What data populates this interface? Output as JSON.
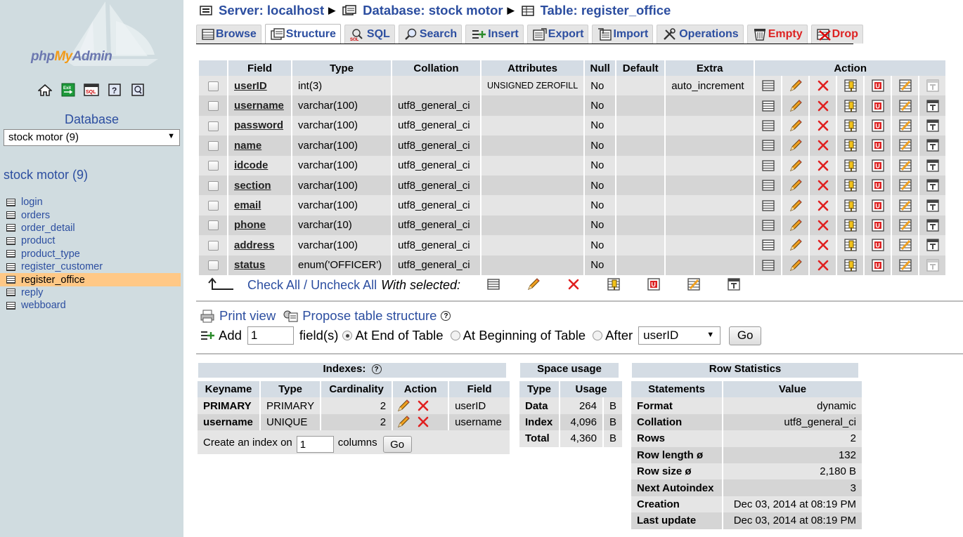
{
  "sidebar": {
    "logo": {
      "part1": "php",
      "part2": "My",
      "part3": "Admin"
    },
    "quick_icons": [
      "home-icon",
      "exit-icon",
      "sql-query-icon",
      "docs-icon",
      "sql-docs-icon"
    ],
    "database_label": "Database",
    "database_select": "stock motor (9)",
    "database_title": "stock motor (9)",
    "tables": [
      {
        "label": "login"
      },
      {
        "label": "orders"
      },
      {
        "label": "order_detail"
      },
      {
        "label": "product"
      },
      {
        "label": "product_type"
      },
      {
        "label": "register_customer"
      },
      {
        "label": "register_office",
        "active": true
      },
      {
        "label": "reply"
      },
      {
        "label": "webboard"
      }
    ],
    "active_color": "#ffc886"
  },
  "breadcrumb": {
    "server": "Server: localhost",
    "database": "Database: stock motor",
    "table": "Table: register_office"
  },
  "tabs": [
    {
      "label": "Browse",
      "icon": "browse-icon"
    },
    {
      "label": "Structure",
      "icon": "structure-icon",
      "active": true
    },
    {
      "label": "SQL",
      "icon": "sql-icon"
    },
    {
      "label": "Search",
      "icon": "search-icon"
    },
    {
      "label": "Insert",
      "icon": "insert-icon"
    },
    {
      "label": "Export",
      "icon": "export-icon"
    },
    {
      "label": "Import",
      "icon": "import-icon"
    },
    {
      "label": "Operations",
      "icon": "operations-icon"
    },
    {
      "label": "Empty",
      "icon": "empty-icon",
      "danger": true
    },
    {
      "label": "Drop",
      "icon": "drop-icon",
      "danger": true
    }
  ],
  "structure": {
    "headers": {
      "field": "Field",
      "type": "Type",
      "collation": "Collation",
      "attributes": "Attributes",
      "null": "Null",
      "default": "Default",
      "extra": "Extra",
      "action": "Action"
    },
    "rows": [
      {
        "field": "userID",
        "type": "int(3)",
        "collation": "",
        "attributes": "UNSIGNED ZEROFILL",
        "null": "No",
        "default": "",
        "extra": "auto_increment"
      },
      {
        "field": "username",
        "type": "varchar(100)",
        "collation": "utf8_general_ci",
        "attributes": "",
        "null": "No",
        "default": "",
        "extra": ""
      },
      {
        "field": "password",
        "type": "varchar(100)",
        "collation": "utf8_general_ci",
        "attributes": "",
        "null": "No",
        "default": "",
        "extra": ""
      },
      {
        "field": "name",
        "type": "varchar(100)",
        "collation": "utf8_general_ci",
        "attributes": "",
        "null": "No",
        "default": "",
        "extra": ""
      },
      {
        "field": "idcode",
        "type": "varchar(100)",
        "collation": "utf8_general_ci",
        "attributes": "",
        "null": "No",
        "default": "",
        "extra": ""
      },
      {
        "field": "section",
        "type": "varchar(100)",
        "collation": "utf8_general_ci",
        "attributes": "",
        "null": "No",
        "default": "",
        "extra": ""
      },
      {
        "field": "email",
        "type": "varchar(100)",
        "collation": "utf8_general_ci",
        "attributes": "",
        "null": "No",
        "default": "",
        "extra": ""
      },
      {
        "field": "phone",
        "type": "varchar(10)",
        "collation": "utf8_general_ci",
        "attributes": "",
        "null": "No",
        "default": "",
        "extra": ""
      },
      {
        "field": "address",
        "type": "varchar(100)",
        "collation": "utf8_general_ci",
        "attributes": "",
        "null": "No",
        "default": "",
        "extra": ""
      },
      {
        "field": "status",
        "type": "enum('OFFICER')",
        "collation": "utf8_general_ci",
        "attributes": "",
        "null": "No",
        "default": "",
        "extra": ""
      }
    ],
    "row_actions": [
      "browse-distinct-icon",
      "edit-icon",
      "delete-icon",
      "primary-key-icon",
      "unique-icon",
      "index-icon",
      "fulltext-icon"
    ]
  },
  "with_selected": {
    "check_all": "Check All",
    "separator": " / ",
    "uncheck_all": "Uncheck All",
    "label": "With selected:"
  },
  "links": {
    "print_view": "Print view",
    "propose": "Propose table structure"
  },
  "add_fields": {
    "add_label": "Add",
    "count_value": "1",
    "fields_label": "field(s)",
    "opt_end": "At End of Table",
    "opt_begin": "At Beginning of Table",
    "opt_after": "After",
    "after_value": "userID",
    "go": "Go"
  },
  "indexes": {
    "title": "Indexes:",
    "headers": {
      "keyname": "Keyname",
      "type": "Type",
      "cardinality": "Cardinality",
      "action": "Action",
      "field": "Field"
    },
    "rows": [
      {
        "keyname": "PRIMARY",
        "type": "PRIMARY",
        "cardinality": "2",
        "field": "userID"
      },
      {
        "keyname": "username",
        "type": "UNIQUE",
        "cardinality": "2",
        "field": "username"
      }
    ],
    "create_label": "Create an index on",
    "create_value": "1",
    "columns_label": "columns",
    "go": "Go"
  },
  "space_usage": {
    "title": "Space usage",
    "headers": {
      "type": "Type",
      "usage": "Usage"
    },
    "rows": [
      {
        "type": "Data",
        "value": "264",
        "unit": "B"
      },
      {
        "type": "Index",
        "value": "4,096",
        "unit": "B"
      },
      {
        "type": "Total",
        "value": "4,360",
        "unit": "B"
      }
    ]
  },
  "row_stats": {
    "title": "Row Statistics",
    "headers": {
      "statements": "Statements",
      "value": "Value"
    },
    "rows": [
      {
        "label": "Format",
        "value": "dynamic"
      },
      {
        "label": "Collation",
        "value": "utf8_general_ci"
      },
      {
        "label": "Rows",
        "value": "2"
      },
      {
        "label": "Row length ø",
        "value": "132"
      },
      {
        "label": "Row size ø",
        "value": "2,180 B"
      },
      {
        "label": "Next Autoindex",
        "value": "3"
      },
      {
        "label": "Creation",
        "value": "Dec 03, 2014 at 08:19 PM"
      },
      {
        "label": "Last update",
        "value": "Dec 03, 2014 at 08:19 PM"
      }
    ]
  }
}
